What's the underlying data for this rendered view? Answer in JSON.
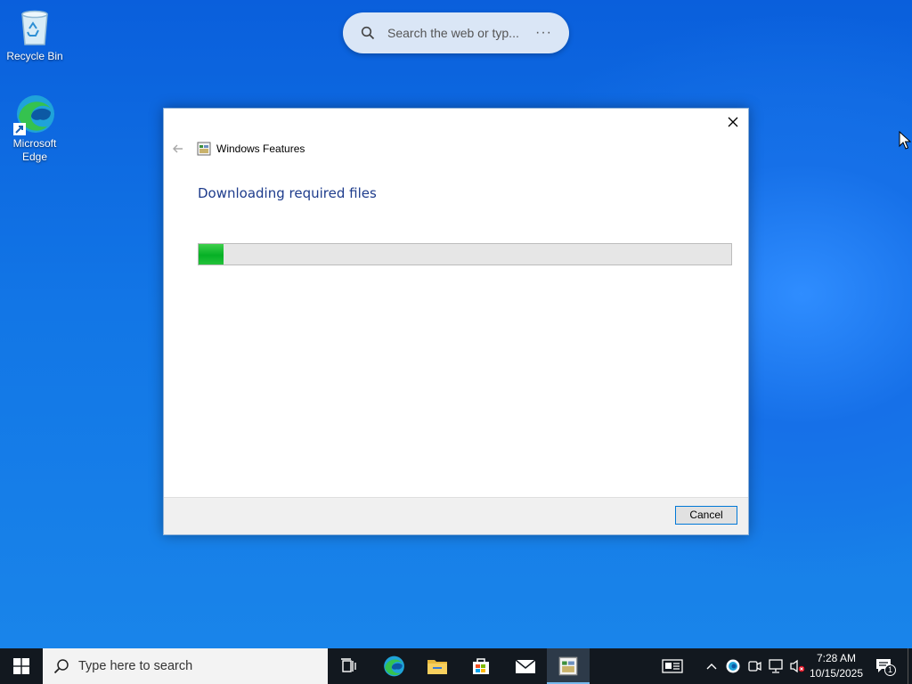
{
  "desktop": {
    "icons": [
      {
        "label": "Recycle Bin",
        "icon": "recycle-bin-icon"
      },
      {
        "label": "Microsoft Edge",
        "icon": "edge-icon"
      }
    ],
    "search_widget": {
      "placeholder": "Search the web or typ...",
      "more": "···"
    }
  },
  "dialog": {
    "window_title": "Windows Features",
    "heading": "Downloading required files",
    "progress_fraction": 0.047,
    "cancel_label": "Cancel",
    "icons": {
      "close": "close-icon",
      "back": "back-arrow-icon",
      "app": "windows-features-icon"
    }
  },
  "taskbar": {
    "search_placeholder": "Type here to search",
    "apps": [
      "task-view-icon",
      "edge-icon",
      "file-explorer-icon",
      "store-icon",
      "mail-icon",
      "windows-features-icon"
    ],
    "tray_icons": [
      "news-icon",
      "chevron-up-icon",
      "edge-tray-icon",
      "meet-now-icon",
      "network-icon",
      "volume-muted-icon"
    ],
    "time": "7:28 AM",
    "date": "10/15/2025",
    "notification_count": "1"
  },
  "colors": {
    "accent": "#0078d7",
    "progress": "#06b025",
    "heading": "#1e3c8c",
    "taskbar": "#12181f"
  }
}
